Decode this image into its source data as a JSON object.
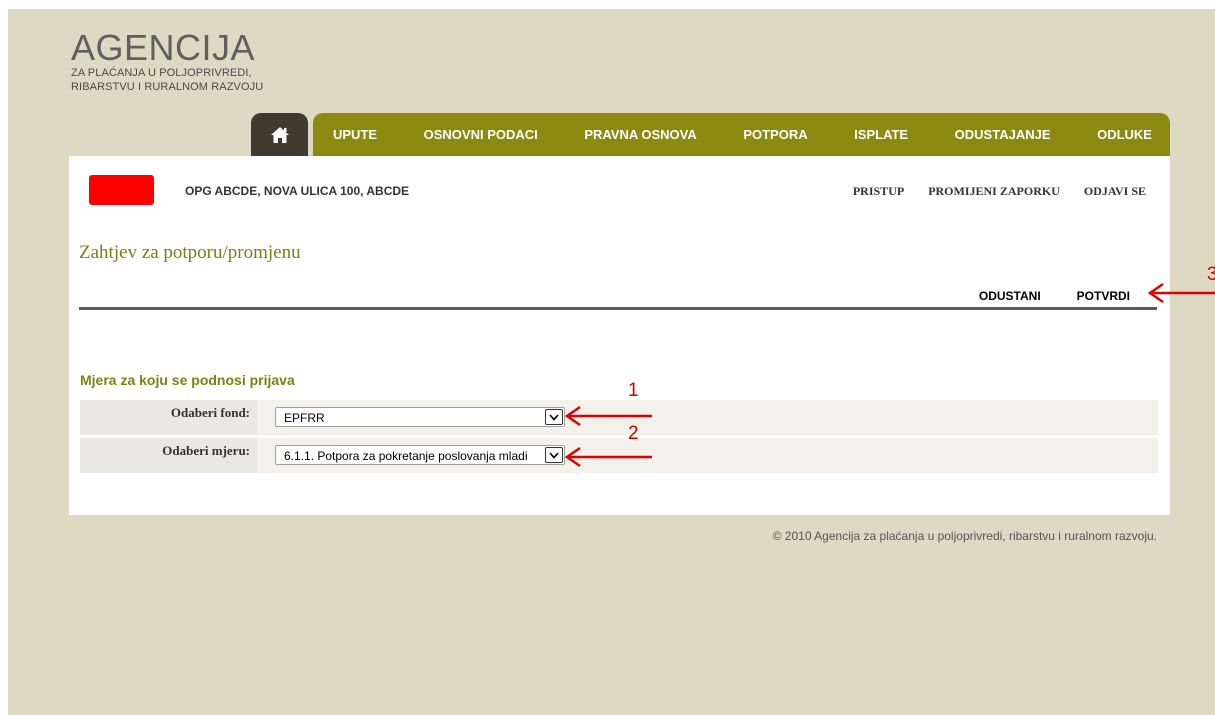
{
  "logo": {
    "title": "AGENCIJA",
    "subtitle_line1": "ZA PLAĆANJA U POLJOPRIVREDI,",
    "subtitle_line2": "RIBARSTVU I RURALNOM RAZVOJU"
  },
  "nav": {
    "home_icon": "home-icon",
    "items": [
      {
        "label": "UPUTE"
      },
      {
        "label": "OSNOVNI PODACI"
      },
      {
        "label": "PRAVNA OSNOVA"
      },
      {
        "label": "POTPORA"
      },
      {
        "label": "ISPLATE"
      },
      {
        "label": "ODUSTAJANJE"
      },
      {
        "label": "ODLUKE"
      }
    ],
    "color": "#8a8a10",
    "home_color": "#3e3a2d"
  },
  "header": {
    "farm_name": "OPG ABCDE, NOVA ULICA 100, ABCDE",
    "links": [
      {
        "label": "PRISTUP"
      },
      {
        "label": "PROMIJENI ZAPORKU"
      },
      {
        "label": "ODJAVI SE"
      }
    ]
  },
  "page": {
    "title": "Zahtjev za potporu/promjenu",
    "actions": {
      "cancel": "ODUSTANI",
      "confirm": "POTVRDI"
    },
    "section_title": "Mjera za koju se podnosi prijava"
  },
  "form": {
    "fund": {
      "label": "Odaberi fond:",
      "value": "EPFRR"
    },
    "measure": {
      "label": "Odaberi mjeru:",
      "value": "6.1.1. Potpora za pokretanje poslovanja mladi"
    }
  },
  "annotations": {
    "one": "1",
    "two": "2",
    "three": "3",
    "color": "#e00000"
  },
  "footer": {
    "copyright": "© 2010 Agencija za plaćanja u poljoprivredi, ribarstvu i ruralnom razvoju."
  }
}
